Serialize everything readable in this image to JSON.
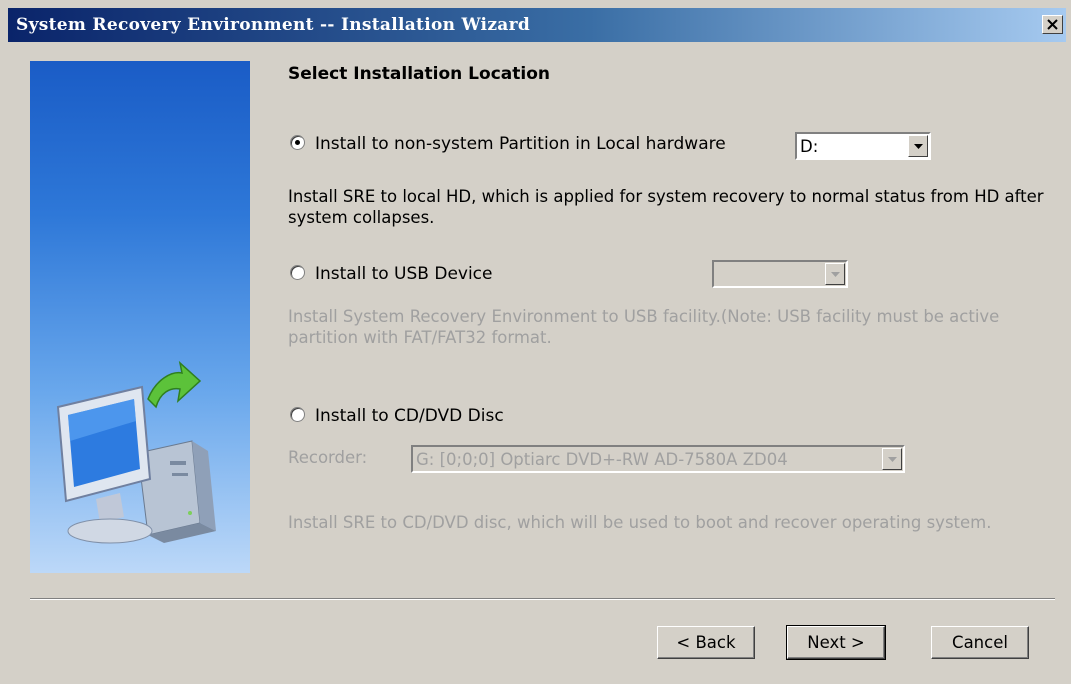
{
  "window": {
    "title": "System Recovery Environment -- Installation Wizard",
    "close_icon": "close-icon"
  },
  "page": {
    "heading": "Select Installation Location"
  },
  "options": {
    "local": {
      "label": "Install to non-system Partition in Local hardware",
      "selected": true,
      "dropdown_value": "D:",
      "description": "Install SRE to local HD, which is applied for system recovery to normal status from HD after system collapses."
    },
    "usb": {
      "label": "Install to USB Device",
      "selected": false,
      "dropdown_value": "",
      "description": "Install System Recovery Environment to USB facility.(Note: USB facility must be active partition with FAT/FAT32 format."
    },
    "cd": {
      "label": "Install to CD/DVD Disc",
      "selected": false,
      "recorder_label": "Recorder:",
      "recorder_value": "G:  [0;0;0] Optiarc  DVD+-RW AD-7580A ZD04",
      "description": "Install SRE to CD/DVD disc, which will be used to boot and recover operating system."
    }
  },
  "buttons": {
    "back": "< Back",
    "next": "Next >",
    "cancel": "Cancel"
  },
  "colors": {
    "title_start": "#0a246a",
    "title_end": "#a6caf0",
    "face": "#d4d0c8",
    "disabled_text": "#a0a0a0"
  },
  "icons": {
    "side_image": "computer-with-green-arrow-icon",
    "dropdown": "chevron-down-icon"
  }
}
